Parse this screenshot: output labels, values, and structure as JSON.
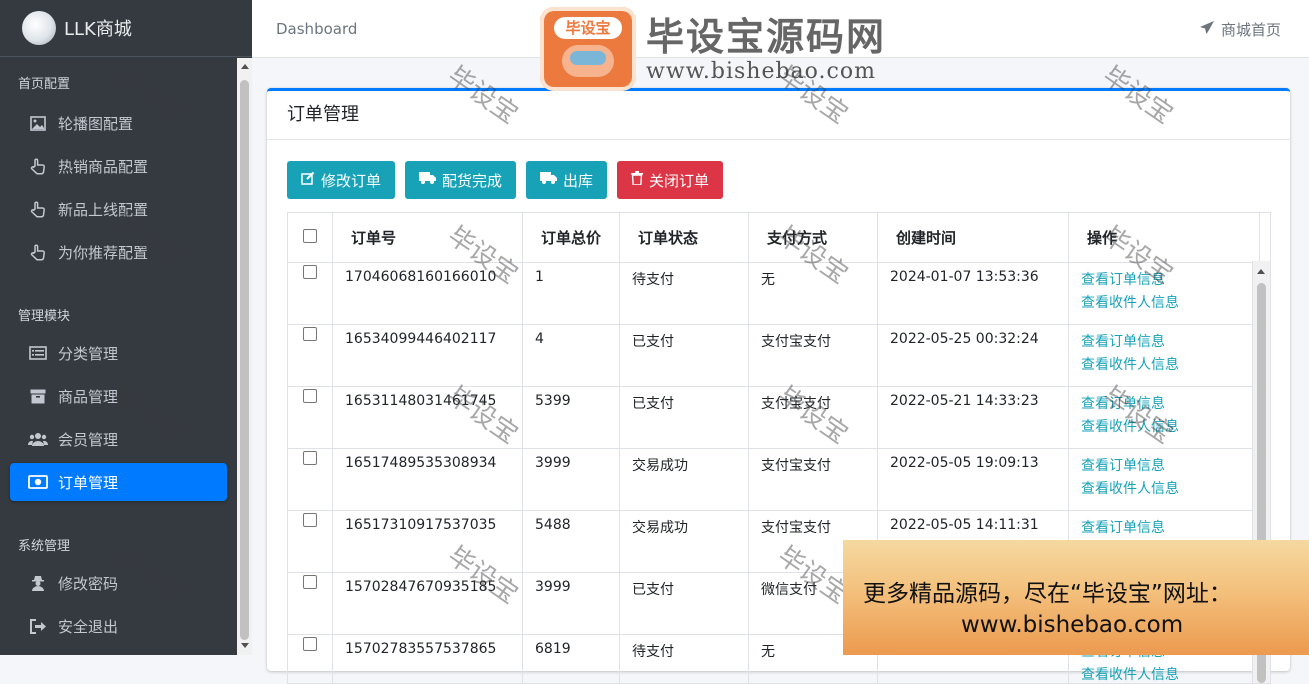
{
  "brand": {
    "name": "LLK商城"
  },
  "sidebar": {
    "sections": [
      {
        "header": "首页配置",
        "items": [
          {
            "label": "轮播图配置",
            "icon": "image-icon"
          },
          {
            "label": "热销商品配置",
            "icon": "hand-pointer-icon"
          },
          {
            "label": "新品上线配置",
            "icon": "hand-pointer-icon"
          },
          {
            "label": "为你推荐配置",
            "icon": "hand-pointer-icon"
          }
        ]
      },
      {
        "header": "管理模块",
        "items": [
          {
            "label": "分类管理",
            "icon": "list-icon"
          },
          {
            "label": "商品管理",
            "icon": "archive-icon"
          },
          {
            "label": "会员管理",
            "icon": "users-icon"
          },
          {
            "label": "订单管理",
            "icon": "money-icon",
            "active": true
          }
        ]
      },
      {
        "header": "系统管理",
        "items": [
          {
            "label": "修改密码",
            "icon": "user-secret-icon"
          },
          {
            "label": "安全退出",
            "icon": "sign-out-icon"
          }
        ]
      }
    ]
  },
  "topbar": {
    "breadcrumb": "Dashboard",
    "home_link": "商城首页"
  },
  "card": {
    "title": "订单管理"
  },
  "toolbar": {
    "edit": "修改订单",
    "packed": "配货完成",
    "ship": "出库",
    "close": "关闭订单"
  },
  "table": {
    "headers": [
      "订单号",
      "订单总价",
      "订单状态",
      "支付方式",
      "创建时间",
      "操作"
    ],
    "action_view_order": "查看订单信息",
    "action_view_receiver": "查看收件人信息",
    "rows": [
      {
        "order_no": "17046068160166010",
        "total": "1",
        "status": "待支付",
        "pay": "无",
        "created": "2024-01-07 13:53:36"
      },
      {
        "order_no": "16534099446402117",
        "total": "4",
        "status": "已支付",
        "pay": "支付宝支付",
        "created": "2022-05-25 00:32:24"
      },
      {
        "order_no": "16531148031461745",
        "total": "5399",
        "status": "已支付",
        "pay": "支付宝支付",
        "created": "2022-05-21 14:33:23"
      },
      {
        "order_no": "16517489535308934",
        "total": "3999",
        "status": "交易成功",
        "pay": "支付宝支付",
        "created": "2022-05-05 19:09:13"
      },
      {
        "order_no": "16517310917537035",
        "total": "5488",
        "status": "交易成功",
        "pay": "支付宝支付",
        "created": "2022-05-05 14:11:31"
      },
      {
        "order_no": "15702847670935185",
        "total": "3999",
        "status": "已支付",
        "pay": "微信支付",
        "created": ""
      },
      {
        "order_no": "15702783557537865",
        "total": "6819",
        "status": "待支付",
        "pay": "无",
        "created": ""
      }
    ]
  },
  "watermark": {
    "text": "毕设宝",
    "logo_badge": "毕设宝",
    "logo_title": "毕设宝源码网",
    "logo_url": "www.bishebao.com",
    "promo_line1": "更多精品源码，尽在“毕设宝”网址：",
    "promo_line2": "www.bishebao.com"
  },
  "colors": {
    "primary": "#007bff",
    "info": "#17a2b8",
    "danger": "#dc3545",
    "sidebar": "#343a40"
  }
}
